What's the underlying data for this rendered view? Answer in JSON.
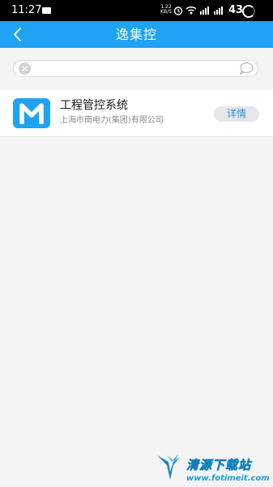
{
  "status_bar": {
    "time": "11:27",
    "speed_value": "1.22",
    "speed_unit": "KB/S",
    "battery": "43"
  },
  "nav": {
    "title": "逸集控",
    "back_icon": "chevron-left-icon"
  },
  "search": {
    "value": "",
    "placeholder": "",
    "clear_icon": "clear-icon",
    "right_icon": "chat-bubble-icon"
  },
  "apps": [
    {
      "name": "工程管控系统",
      "company": "上海市南电力(集团)有限公司",
      "action_label": "详情",
      "icon": "m-logo-icon"
    }
  ],
  "watermark": {
    "title": "清源下载站",
    "url": "www.fotimeit.com"
  },
  "colors": {
    "primary": "#1fa3f5",
    "background": "#f5f4f5"
  }
}
